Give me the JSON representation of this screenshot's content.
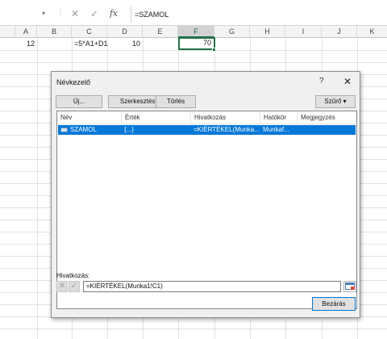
{
  "formula_bar": {
    "formula": "=SZAMOL",
    "cancel_icon": "x-mark",
    "confirm_icon": "check-mark",
    "function_label": "fx"
  },
  "columns": [
    "A",
    "B",
    "C",
    "D",
    "E",
    "F",
    "G",
    "H",
    "I",
    "J",
    "K"
  ],
  "active_column": "F",
  "cells": {
    "a1": "12",
    "c1": "=5*A1+D1",
    "d1": "10",
    "f1": "70"
  },
  "dialog": {
    "title": "Névkezelő",
    "help": "?",
    "close": "✕",
    "buttons": {
      "new": "Új...",
      "edit": "Szerkesztés...",
      "delete": "Törlés",
      "filter": "Szűrő"
    },
    "list": {
      "headers": [
        "Név",
        "Érték",
        "Hivatkozás",
        "Hatókör",
        "Megjegyzés"
      ],
      "rows": [
        {
          "name": "SZAMOL",
          "value": "{...}",
          "reference": "=KIÉRTÉKEL(Munka...",
          "scope": "Munkaf...",
          "note": ""
        }
      ]
    },
    "reference_label": "Hivatkozás:",
    "reference_value": "=KIÉRTÉKEL(Munka1!C1)",
    "close_button": "Bezárás"
  }
}
